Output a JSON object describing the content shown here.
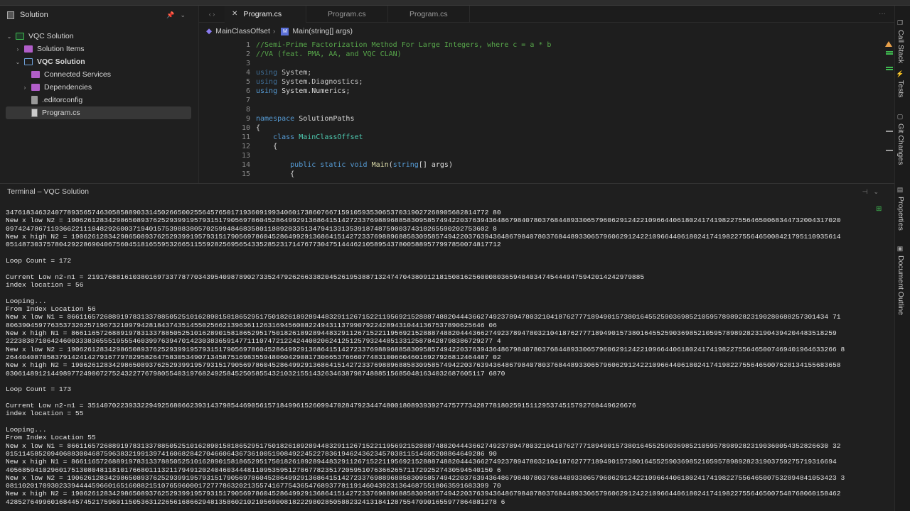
{
  "solution_panel": {
    "title": "Solution",
    "tree": [
      {
        "label": "VQC Solution",
        "icon": "solution-icon",
        "expanded": true
      },
      {
        "label": "Solution Items",
        "icon": "folder-icon",
        "expanded": false
      },
      {
        "label": "VQC Solution",
        "icon": "project-icon",
        "expanded": true
      },
      {
        "label": "Connected Services",
        "icon": "folder-icon"
      },
      {
        "label": "Dependencies",
        "icon": "folder-icon",
        "expanded": false
      },
      {
        "label": ".editorconfig",
        "icon": "file-icon"
      },
      {
        "label": "Program.cs",
        "icon": "csharp-file-icon",
        "selected": true
      }
    ]
  },
  "editor": {
    "tabs": [
      {
        "label": "Program.cs",
        "active": true
      },
      {
        "label": "Program.cs"
      },
      {
        "label": "Program.cs"
      }
    ],
    "breadcrumb": {
      "class": "MainClassOffset",
      "method": "Main(string[] args)"
    },
    "lines": [
      {
        "n": "1",
        "tokens": [
          {
            "t": "//Semi-Prime Factorization Method For Large Integers, where c = a * b",
            "k": "comment"
          }
        ]
      },
      {
        "n": "2",
        "tokens": [
          {
            "t": "//VA (feat. PMA, AA, and VQC CLAN)",
            "k": "comment"
          }
        ]
      },
      {
        "n": "3",
        "tokens": []
      },
      {
        "n": "4",
        "tokens": [
          {
            "t": "using",
            "k": "keyword-dim"
          },
          {
            "t": " System;",
            "k": "dim"
          }
        ]
      },
      {
        "n": "5",
        "tokens": [
          {
            "t": "using",
            "k": "keyword-dim"
          },
          {
            "t": " System.Diagnostics;",
            "k": "dim"
          }
        ]
      },
      {
        "n": "6",
        "tokens": [
          {
            "t": "using",
            "k": "keyword"
          },
          {
            "t": " System.Numerics;",
            "k": "plain"
          }
        ]
      },
      {
        "n": "7",
        "tokens": []
      },
      {
        "n": "8",
        "tokens": []
      },
      {
        "n": "9",
        "tokens": [
          {
            "t": "namespace",
            "k": "keyword"
          },
          {
            "t": " SolutionPaths",
            "k": "plain"
          }
        ]
      },
      {
        "n": "10",
        "tokens": [
          {
            "t": "{",
            "k": "plain"
          }
        ]
      },
      {
        "n": "11",
        "tokens": [
          {
            "t": "    class",
            "k": "keyword"
          },
          {
            "t": " MainClassOffset",
            "k": "type"
          }
        ]
      },
      {
        "n": "12",
        "tokens": [
          {
            "t": "    {",
            "k": "plain"
          }
        ]
      },
      {
        "n": "13",
        "tokens": []
      },
      {
        "n": "14",
        "tokens": [
          {
            "t": "        public static void",
            "k": "keyword"
          },
          {
            "t": " Main",
            "k": "method"
          },
          {
            "t": "(",
            "k": "plain"
          },
          {
            "t": "string",
            "k": "keyword"
          },
          {
            "t": "[] args)",
            "k": "plain"
          }
        ]
      },
      {
        "n": "15",
        "tokens": [
          {
            "t": "        {",
            "k": "plain"
          }
        ]
      }
    ]
  },
  "right_toolbar": [
    "Call Stack",
    "Tests",
    "Git Changes",
    "Properties",
    "Document Outline"
  ],
  "terminal": {
    "title": "Terminal – VQC Solution",
    "lines": [
      "3476183463240778935657463058588903314502665002556457650171936091993406017386076671591059353065370319027268905682814772 80",
      "New x low N2 = 190626128342986508937625293991957931517905697860452864992913686415142723376988968858309585749422037639436486798407803768448933065796062912422109664406180241741982275564650068344732004317020",
      "0974247867119366221110482926003719401575398838057025994846835801188928335134794133135391874875900374310265590202753602 8",
      "New x high N2 = 19062612834298650893762529399195793151790569786045286499291368641514272337698896885830958574942203763943648679840780376844893306579606291242210966440618024174198227556465008421795110935614",
      "0514873037578042922869040675604518165595326651155928256956543352852317147677304751444621058954378005889577997850074817712",
      "",
      "Loop Count = 172",
      "",
      "Current Low n2-n1 = 2191768816103801697337787703439540987890273352479262663382045261953887132474704380912181508162560008036594840347454449475942014242979885",
      "index location = 56",
      "",
      "Looping...",
      "From Index Location 56",
      "New x low N1 = 866116572688919783133788505251016289015818652951750182618928944832911267152211956921528887488204443662749237894780321041876277718949015738016455259036985210595789892823190280688257301434 71",
      "806390459776353732625719673210979428184374351455025662139636112631694560082249431137990792242894310441367537890625646 06",
      "New x high N1 = 8661165726889197831337885052510162890158186529517501826189289448329112671522119569215288874882044436627492378947803210418762777189490157380164552590369852105957898928231904394204483518259",
      "22238387106424600333836555195554603997639470142303836591477111074721224244082062412512579324485133125878428798386729277 4",
      "New x low N2 = 19062612834298650893762529399195793151790569786045286499291368641514272337698896885830958574942203763943648679840780376844893306579606291242210966440618024174198227556465007469401964633266 8",
      "2644040870583791424142791677978295826475830534907134587516983559480604290817306653766607748310066046016927926812464487 02",
      "New x high N2 = 19062612834298650893762529399195793151790569786045286499291368641514272337698896885830958574942203763943648679840780376844893306579606291242210966440618024174198227556465007628134155683658",
      "030614891214498977249007275243227767980554031976824925845250585543210321551432634638798748885156850481634032687605117 6870",
      "",
      "Loop Count = 173",
      "",
      "Current Low n2-n1 = 35140702239332294925680662393143798544690561571849961526099470284792344748001808939392747577734287781802591511295374515792768449626676",
      "index location = 55",
      "",
      "Looping...",
      "From Index Location 55",
      "New x low N1 = 866116572688919783133788505251016289015818652951750182618928944832911267152211956921528887488204443662749237894780321041876277718949015738016455259036985210595789892823190360054352826630 32",
      "015114585209406883004687596383219913974160682842704660643673610051908492245227836194624362345703811514605208864649286 90",
      "New x high N1 = 8661165726889197831337885052510162890158186529517501826189289448329112671522119569215288874882044436627492378947803210418762777189490157380164552590369852105957898928231903759275719316694",
      "40568594102960175130804811810176680111321179491202404603444811095359512786778235172059510763662657117292527430594540150 6",
      "New x low N2 = 19062612834298650893762529399195793151790569786045286499291368641514272337698896885830958574942203763943648679840780376844893306579606291242210966440618024174198227556465007532894841053423 3",
      "0811020170930233944445966016516088215107659600017277786320213557416775436547689377811914604392313646875518063591683399 70",
      "New x high N2 = 19062612834298650893762529399195793151790569786045286499291368641514272337698896885830958574942203763943648679840780376844893306579606291242210966440618024174198227556465007548768060158462",
      "428527649960168445745217596011505363122656168662948135860210210569008182229802850588232413184128755470901655977864881278 6"
    ]
  },
  "colors": {
    "comment": "#57a64a",
    "keyword": "#569cd6",
    "type": "#4ec9b0",
    "method": "#dcdcaa",
    "warning": "#e8a04a",
    "added": "#3fb950"
  }
}
